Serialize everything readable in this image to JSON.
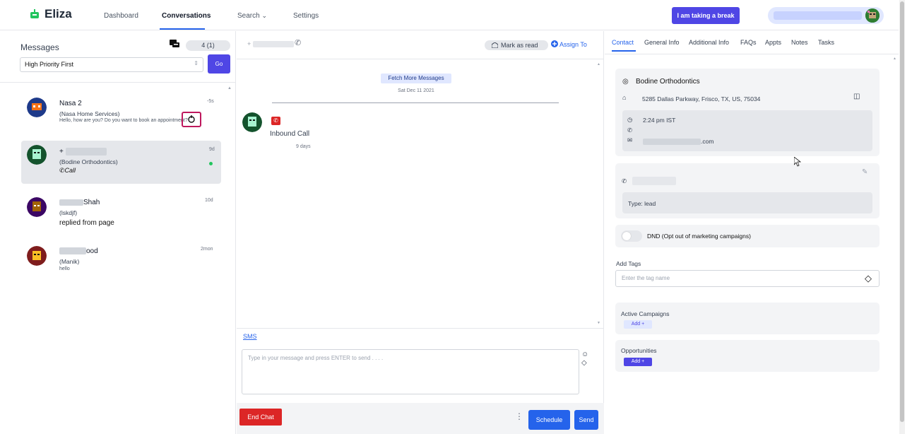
{
  "nav": {
    "logo": "Eliza",
    "items": [
      "Dashboard",
      "Conversations",
      "Search",
      "Settings"
    ],
    "break_button": "I am taking a break"
  },
  "messages": {
    "title": "Messages",
    "count": "4 (1)",
    "filter": "High Priority First",
    "go": "Go",
    "conversations": [
      {
        "name": "Nasa 2",
        "business": "(Nasa Home Services)",
        "preview": "Hello, how are you? Do you want to book an appointment?",
        "time": "-5s"
      },
      {
        "name": "+",
        "business": "(Bodine Orthodontics)",
        "preview": "Call",
        "time": "9d"
      },
      {
        "name": "Shah",
        "business": "(lskdjf)",
        "preview": "replied from page",
        "time": "10d"
      },
      {
        "name": "ood",
        "business": "(Manik)",
        "preview": "hello",
        "time": "2mon"
      }
    ]
  },
  "chat": {
    "header_phone": "+",
    "mark_as_read": "Mark as read",
    "assign_to": "Assign To",
    "fetch_more": "Fetch More Messages",
    "date": "Sat Dec 11 2021",
    "message_text": "Inbound Call",
    "message_time": "9 days",
    "channel_tab": "SMS",
    "composer_placeholder": "Type in your message and press ENTER to send . . . .",
    "end_chat": "End Chat",
    "schedule": "Schedule",
    "send": "Send"
  },
  "contact": {
    "tabs": [
      "Contact",
      "General Info",
      "Additional Info",
      "FAQs",
      "Appts",
      "Notes",
      "Tasks"
    ],
    "business_name": "Bodine Orthodontics",
    "address": "5285 Dallas Parkway, Frisco, TX, US, 75034",
    "local_time": "2:24 pm IST",
    "email_suffix": ".com",
    "type": "Type: lead",
    "dnd": "DND (Opt out of marketing campaigns)",
    "add_tags_label": "Add Tags",
    "tag_placeholder": "Enter the tag name",
    "active_campaigns": "Active Campaigns",
    "opportunities": "Opportunities",
    "add": "Add"
  },
  "colors": {
    "primary": "#4f46e5",
    "link": "#2563eb",
    "danger": "#dc2626",
    "highlight": "#be185d"
  }
}
